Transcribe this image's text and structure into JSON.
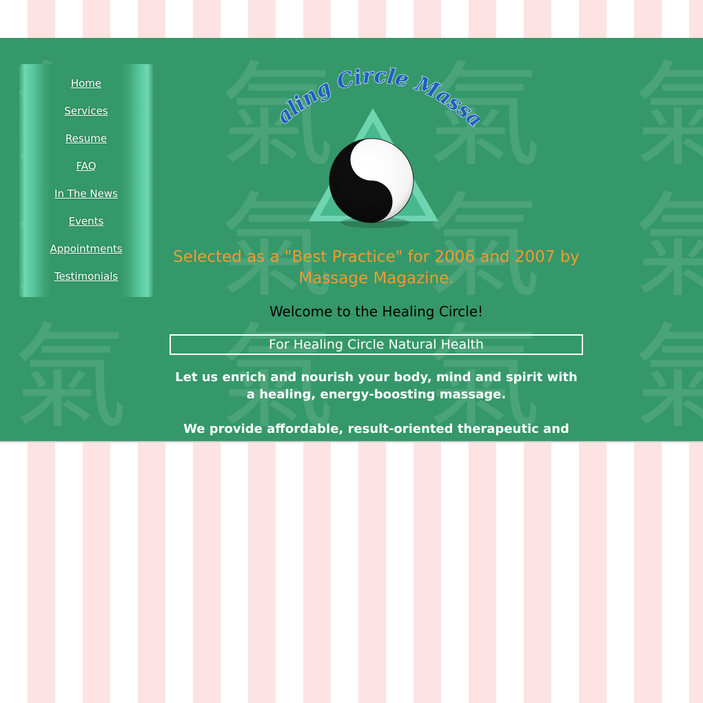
{
  "colors": {
    "panel_background": "#35986a",
    "page_stripe_pink": "#fde3e3",
    "award_text": "#f29a30",
    "logo_script_blue": "#1f5fc0",
    "triangle_green": "#6fd4b0"
  },
  "nav": {
    "items": [
      {
        "label": "Home"
      },
      {
        "label": "Services"
      },
      {
        "label": "Resume"
      },
      {
        "label": "FAQ"
      },
      {
        "label": "In The News"
      },
      {
        "label": "Events"
      },
      {
        "label": "Appointments"
      },
      {
        "label": "Testimonials"
      }
    ]
  },
  "logo": {
    "text": "Healing Circle Massage",
    "icon": "yin-yang-icon"
  },
  "content": {
    "award": "Selected as a \"Best Practice\" for 2006 and 2007 by Massage Magazine.",
    "welcome": "Welcome to the Healing Circle!",
    "boxed_title": "For Healing Circle Natural Health",
    "paragraph_1": "Let us enrich and nourish your body, mind and spirit with a healing, energy-boosting massage.",
    "paragraph_2": "We provide affordable, result-oriented therapeutic and"
  },
  "background": {
    "watermark_glyph": "氣"
  }
}
